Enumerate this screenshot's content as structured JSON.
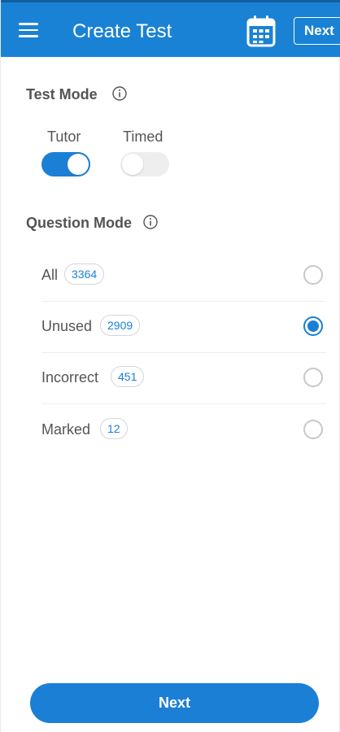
{
  "header": {
    "title": "Create Test",
    "menu_icon": "hamburger-menu-icon",
    "calendar_icon": "calendar-icon",
    "next_label": "Next",
    "bg_color": "#1a82d4"
  },
  "test_mode": {
    "title": "Test Mode",
    "info_icon": "info-icon",
    "toggles": [
      {
        "label": "Tutor",
        "on": true
      },
      {
        "label": "Timed",
        "on": false
      }
    ]
  },
  "question_mode": {
    "title": "Question Mode",
    "info_icon": "info-icon",
    "options": [
      {
        "label": "All",
        "count": "3364",
        "selected": false
      },
      {
        "label": "Unused",
        "count": "2909",
        "selected": true
      },
      {
        "label": "Incorrect",
        "count": "451",
        "selected": false
      },
      {
        "label": "Marked",
        "count": "12",
        "selected": false
      }
    ]
  },
  "footer": {
    "next_label": "Next"
  },
  "colors": {
    "accent": "#1c7fd6"
  }
}
